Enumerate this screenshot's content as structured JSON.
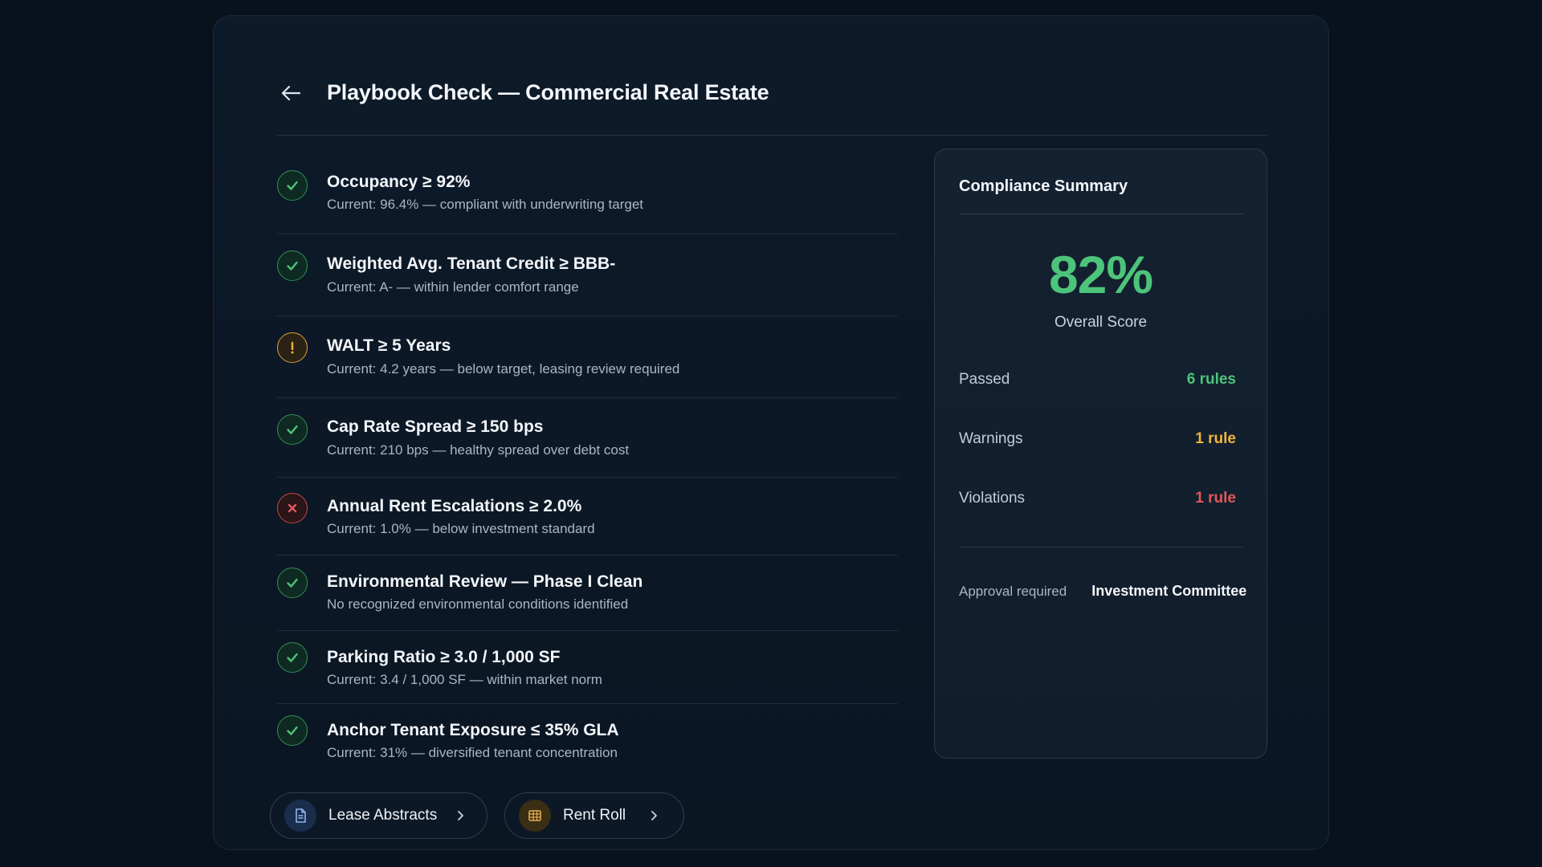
{
  "header": {
    "title": "Playbook Check — Commercial Real Estate",
    "back_icon": "arrow-left-icon"
  },
  "rules": [
    {
      "status": "pass",
      "title": "Occupancy ≥ 92%",
      "description": "Current: 96.4% — compliant with underwriting target"
    },
    {
      "status": "pass",
      "title": "Weighted Avg. Tenant Credit ≥ BBB-",
      "description": "Current: A- — within lender comfort range"
    },
    {
      "status": "warning",
      "title": "WALT ≥ 5 Years",
      "description": "Current: 4.2 years — below target, leasing review required"
    },
    {
      "status": "pass",
      "title": "Cap Rate Spread ≥ 150 bps",
      "description": "Current: 210 bps — healthy spread over debt cost"
    },
    {
      "status": "fail",
      "title": "Annual Rent Escalations ≥ 2.0%",
      "description": "Current: 1.0% — below investment standard"
    },
    {
      "status": "pass",
      "title": "Environmental Review — Phase I Clean",
      "description": "No recognized environmental conditions identified"
    },
    {
      "status": "pass",
      "title": "Parking Ratio ≥ 3.0 / 1,000 SF",
      "description": "Current: 3.4 / 1,000 SF — within market norm"
    },
    {
      "status": "pass",
      "title": "Anchor Tenant Exposure ≤ 35% GLA",
      "description": "Current: 31% — diversified tenant concentration"
    }
  ],
  "summary": {
    "title": "Compliance Summary",
    "score": "82%",
    "score_label": "Overall Score",
    "passed_label": "Passed",
    "passed_value": "6 rules",
    "warnings_label": "Warnings",
    "warnings_value": "1 rule",
    "violations_label": "Violations",
    "violations_value": "1 rule",
    "approval_label": "Approval required",
    "approval_value": "Investment Committee"
  },
  "links": [
    {
      "label": "Lease Abstracts",
      "icon": "document-icon"
    },
    {
      "label": "Rent Roll",
      "icon": "table-grid-icon"
    }
  ],
  "colors": {
    "pass": "#4cc47a",
    "warning": "#f0b43c",
    "fail": "#e2585a",
    "background": "#08111c"
  }
}
